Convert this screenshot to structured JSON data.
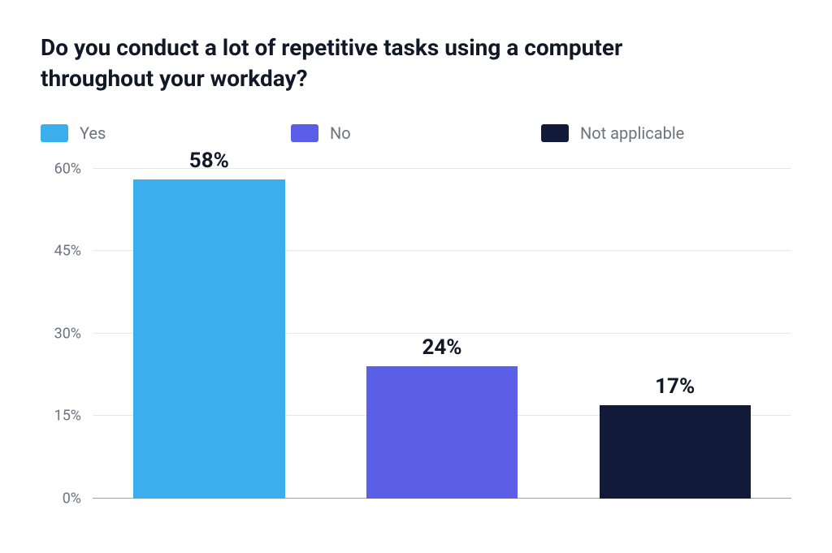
{
  "chart_data": {
    "type": "bar",
    "title": "Do you conduct a lot of repetitive tasks using a computer throughout your workday?",
    "categories": [
      "Yes",
      "No",
      "Not applicable"
    ],
    "values": [
      58,
      24,
      17
    ],
    "value_suffix": "%",
    "colors": [
      "#3BAFED",
      "#5B5FE8",
      "#121A3A"
    ],
    "ylabel": "",
    "xlabel": "",
    "ylim": [
      0,
      60
    ],
    "yticks": [
      0,
      15,
      30,
      45,
      60
    ],
    "ytick_labels": [
      "0%",
      "15%",
      "30%",
      "45%",
      "60%"
    ]
  },
  "legend": {
    "items": [
      {
        "label": "Yes",
        "color": "#3BAFED"
      },
      {
        "label": "No",
        "color": "#5B5FE8"
      },
      {
        "label": "Not applicable",
        "color": "#121A3A"
      }
    ]
  },
  "bar_labels": [
    "58%",
    "24%",
    "17%"
  ]
}
